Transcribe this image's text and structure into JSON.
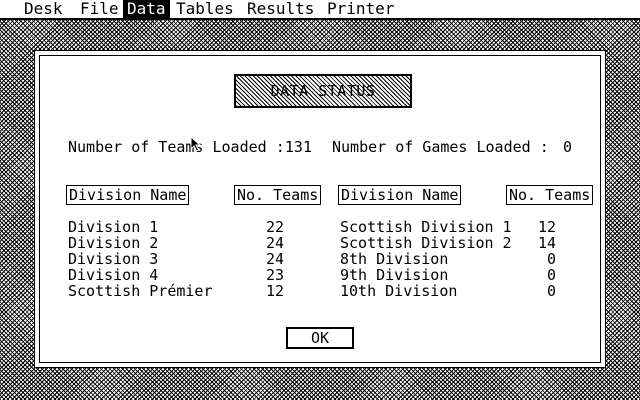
{
  "menu": {
    "items": [
      "Desk",
      "File",
      "Data",
      "Tables",
      "Results",
      "Printer"
    ],
    "active_index": 2
  },
  "dialog": {
    "title": "DATA STATUS",
    "teams_loaded_label": "Number of Teams Loaded :",
    "teams_loaded_value": "131",
    "games_loaded_label": "Number of Games Loaded :",
    "games_loaded_value": "0",
    "headers": {
      "division_name": "Division Name",
      "no_teams": "No. Teams"
    },
    "left_divisions": [
      {
        "name": "Division 1",
        "teams": "22"
      },
      {
        "name": "Division 2",
        "teams": "24"
      },
      {
        "name": "Division 3",
        "teams": "24"
      },
      {
        "name": "Division 4",
        "teams": "23"
      },
      {
        "name": "Scottish Prémier",
        "teams": "12"
      }
    ],
    "right_divisions": [
      {
        "name": "Scottish Division 1",
        "teams": "12"
      },
      {
        "name": "Scottish Division 2",
        "teams": "14"
      },
      {
        "name": "8th Division",
        "teams": "0"
      },
      {
        "name": "9th Division",
        "teams": "0"
      },
      {
        "name": "10th Division",
        "teams": "0"
      }
    ],
    "ok_label": "OK"
  }
}
